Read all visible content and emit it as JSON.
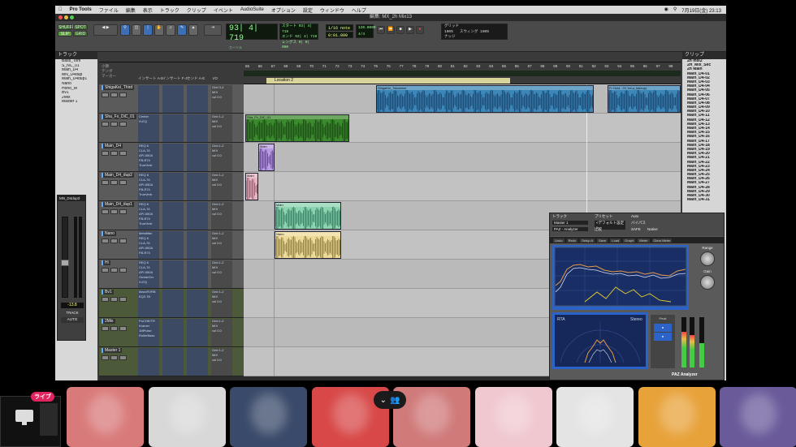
{
  "menubar": {
    "app": "Pro Tools",
    "items": [
      "ファイル",
      "編集",
      "表示",
      "トラック",
      "クリップ",
      "イベント",
      "AudioSuite",
      "オプション",
      "設定",
      "ウィンドウ",
      "ヘルプ"
    ],
    "clock": "7月19日(金) 23:13"
  },
  "window": {
    "title": "編集: MX_2h Mix13"
  },
  "transport": {
    "mode_buttons": [
      "SHUFFLE",
      "SPOT",
      "SLIP",
      "GRID"
    ],
    "counter_main": "93| 4| 719",
    "start_label": "スタート",
    "end_label": "エンド",
    "length_label": "レングス",
    "start": "93| 4| 719",
    "end": "93| 4| 719",
    "length": "0| 0| 000",
    "tempo": "120.0000",
    "meter": "4/4",
    "grid_label": "グリッド",
    "grid_value": "1/16 note",
    "nudge_label": "ナッジ",
    "nudge_value": "0:01.000",
    "zoom_label": "100%",
    "swing_label": "スウィング",
    "swing_value": "100%",
    "counter_label": "カーソル"
  },
  "tracks_panel": {
    "header": "トラック",
    "items": [
      "Bass_Tom",
      "S_NC_01",
      "Main_D4",
      "MN_D4dup",
      "Main_D4dup1",
      "Nano",
      "Hono_M",
      "Bv1",
      "2Mix",
      "Master 1"
    ]
  },
  "edit_window": {
    "column_headers": [
      "インサート A-E",
      "インサート F-J",
      "センド A-E",
      "I/O"
    ],
    "marker": "Location 2",
    "ruler_labels": [
      "小節",
      "テンポ",
      "マーカー"
    ],
    "bars": [
      "65",
      "66",
      "67",
      "68",
      "69",
      "70",
      "71",
      "72",
      "73",
      "74",
      "75",
      "76",
      "77",
      "78",
      "79",
      "80",
      "81",
      "82",
      "83",
      "84",
      "85",
      "86",
      "87",
      "88",
      "89",
      "90",
      "91",
      "92",
      "93",
      "94",
      "95",
      "96",
      "97",
      "98"
    ],
    "tracks": [
      {
        "name": "ShigaKei_Third",
        "inserts": [
          "",
          "",
          ""
        ],
        "io": [
          "Grid 3-4",
          "MIX",
          "vol 0.0"
        ],
        "green": false
      },
      {
        "name": "Sha_Fx_DiC_01",
        "inserts": [
          "Center",
          "H-EQ",
          ""
        ],
        "io": [
          "Grid 1-2",
          "MIX",
          "vol 0.0"
        ],
        "green": false
      },
      {
        "name": "Main_D4",
        "inserts": [
          "REQ 6",
          "CLA-76",
          "API-550A",
          "FB-R74",
          "TrueVerb"
        ],
        "io": [
          "Grid 1-2",
          "MIX",
          "vol 0.0"
        ],
        "green": false
      },
      {
        "name": "Main_D4_dup2",
        "inserts": [
          "REQ 6",
          "CLA-76",
          "API-550A",
          "FB-R74",
          "TrueVerb"
        ],
        "io": [
          "Grid 1-2",
          "MIX",
          "vol 0.0"
        ],
        "green": false
      },
      {
        "name": "Main_D4_dup1",
        "inserts": [
          "REQ 6",
          "CLA-76",
          "API-550A",
          "FB-R74",
          "TrueVerb"
        ],
        "io": [
          "Grid 1-2",
          "MIX",
          "vol 0.0"
        ],
        "green": false
      },
      {
        "name": "Nano",
        "inserts": [
          "Metafilter",
          "REQ 6",
          "CLA-76",
          "API-550A",
          "FB-R74"
        ],
        "io": [
          "Grid 1-2",
          "MIX",
          "vol 0.0"
        ],
        "green": false
      },
      {
        "name": "Hi",
        "inserts": [
          "REQ 6",
          "CLA-76",
          "API-550A",
          "OmbieGrv",
          "H-EQ"
        ],
        "io": [
          "Grid 1-2",
          "MIX",
          "vol 0.0"
        ],
        "green": false
      },
      {
        "name": "Bv1",
        "inserts": [
          "MaxxRVRB",
          "EQ3 7B",
          ""
        ],
        "io": [
          "Grid 1-2",
          "MIX",
          "vol 0.0"
        ],
        "green": true
      },
      {
        "name": "2Mix",
        "inserts": [
          "PuCHE/TR",
          "Kramer",
          "1MPulse",
          "RollerBass"
        ],
        "io": [
          "Grid 1-2",
          "MIX",
          "vol 0.0"
        ],
        "green": true
      },
      {
        "name": "Master 1",
        "inserts": [
          "",
          "",
          ""
        ],
        "io": [
          "Grid 1-2",
          "MIX",
          "vol 0.0"
        ],
        "green": true
      }
    ],
    "clips": [
      {
        "label": "ShigaKei_Takamine",
        "lane": 0
      },
      {
        "label": "Fr Hold - 01 1st.a_takeup)",
        "lane": 0
      },
      {
        "label": "Sha_Fx_DiC_01",
        "lane": 1
      },
      {
        "label": "Main",
        "lane": 2
      },
      {
        "label": "Main",
        "lane": 3
      },
      {
        "label": "Main",
        "lane": 4
      },
      {
        "label": "Nano",
        "lane": 5
      }
    ],
    "mixstrip": {
      "name": "MN_D4dup3",
      "vol": "-13.8",
      "track_label": "TRACK",
      "auto": "AUTO"
    }
  },
  "clips_panel": {
    "header": "クリップ",
    "items": [
      "2h mix2",
      "2H_Mix_Sec",
      "2h Main",
      "Main_D4-01",
      "Main_D4-02",
      "Main_D4-03",
      "Main_D4-04",
      "Main_D4-05",
      "Main_D4-06",
      "Main_D4-07",
      "Main_D4-08",
      "Main_D4-09",
      "Main_D4-10",
      "Main_D4-11",
      "Main_D4-12",
      "Main_D4-13",
      "Main_D4-14",
      "Main_D4-15",
      "Main_D4-16",
      "Main_D4-17",
      "Main_D4-18",
      "Main_D4-19",
      "Main_D4-20",
      "Main_D4-21",
      "Main_D4-22",
      "Main_D4-23",
      "Main_D4-24",
      "Main_D4-25",
      "Main_D4-26",
      "Main_D4-27",
      "Main_D4-28",
      "Main_D4-29",
      "Main_D4-30",
      "Main_D4-31"
    ]
  },
  "plugin": {
    "track_label": "トラック",
    "preset_label": "プリセット",
    "auto_label": "Auto",
    "track_value": "Master 1",
    "plugin_value": "PAZ - Analyzer",
    "preset_value": "<デフォルト設定>",
    "bypass": "バイパス",
    "compare": "比較",
    "safe": "SAFE",
    "native": "Native",
    "title": "PAZ Analyzer",
    "toolbar": [
      "Undo",
      "Redo",
      "Setup A",
      "Save",
      "Load",
      "Graph",
      "Meter",
      "Clear Meter"
    ],
    "knob1": "Range",
    "knob2": "Gain",
    "rta_label": "RTA",
    "scale_label": "Stereo",
    "peak": "Peak",
    "accent": "#2b63c8"
  },
  "meeting": {
    "live_badge": "ライブ",
    "tiles_colors": [
      "#d97a7a",
      "#d8d8d8",
      "#3a4a6a",
      "#d84848",
      "#d07a7a",
      "#f0c8d0",
      "#e4e4e4",
      "#e8a23a",
      "#6a5a9a"
    ]
  }
}
